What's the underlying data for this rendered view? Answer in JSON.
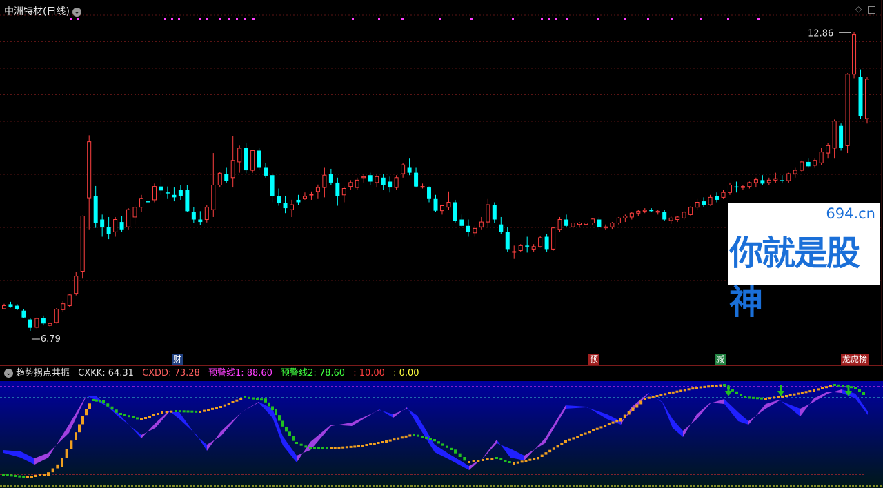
{
  "window": {
    "stock_title": "中洲特材(日线)"
  },
  "price_labels": {
    "high": "12.86",
    "low": "6.79"
  },
  "event_tags": [
    {
      "label": "财",
      "color": "#2060c0"
    },
    {
      "label": "预",
      "color": "#c83030"
    },
    {
      "label": "减",
      "color": "#20a040"
    },
    {
      "label": "龙虎榜",
      "color": "#c83030"
    }
  ],
  "logo": {
    "domain": "694.cn",
    "slogan": "你就是股神"
  },
  "indicator": {
    "name": "趋势拐点共振",
    "cxkk": "CXKK: 64.31",
    "cxdd": "CXDD: 73.28",
    "warn1": "预警线1: 88.60",
    "warn2": "预警线2: 78.60",
    "v10": ": 10.00",
    "v0": ": 0.00"
  },
  "colors": {
    "up": "#ff4040",
    "down": "#00ffff",
    "purple": "#a040e0",
    "blue": "#2020ff",
    "orange": "#f0a020",
    "green": "#20c020",
    "magenta": "#ff40ff"
  },
  "chart_data": {
    "type": "candlestick",
    "series": "daily OHLC (estimated)",
    "ylim": [
      6.3,
      13.2
    ],
    "candles": [
      [
        7.24,
        7.34,
        7.24,
        7.3
      ],
      [
        7.33,
        7.38,
        7.26,
        7.28
      ],
      [
        7.3,
        7.33,
        7.21,
        7.23
      ],
      [
        7.2,
        7.23,
        7.05,
        7.06
      ],
      [
        7.02,
        7.04,
        6.79,
        6.85
      ],
      [
        6.86,
        7.06,
        6.82,
        7.04
      ],
      [
        7.05,
        7.1,
        6.9,
        6.94
      ],
      [
        6.9,
        6.96,
        6.86,
        6.94
      ],
      [
        6.96,
        7.25,
        6.94,
        7.23
      ],
      [
        7.22,
        7.4,
        7.18,
        7.34
      ],
      [
        7.3,
        7.53,
        7.28,
        7.52
      ],
      [
        7.55,
        7.98,
        7.51,
        7.9
      ],
      [
        8.0,
        9.13,
        7.85,
        9.12
      ],
      [
        9.49,
        10.76,
        8.85,
        10.63
      ],
      [
        9.52,
        9.73,
        8.88,
        8.98
      ],
      [
        9.05,
        9.15,
        8.7,
        8.9
      ],
      [
        8.9,
        9.1,
        8.65,
        8.75
      ],
      [
        8.8,
        9.1,
        8.7,
        9.05
      ],
      [
        9.0,
        9.12,
        8.8,
        8.85
      ],
      [
        8.9,
        9.28,
        8.85,
        9.25
      ],
      [
        9.1,
        9.35,
        8.95,
        9.3
      ],
      [
        9.3,
        9.55,
        9.2,
        9.48
      ],
      [
        9.42,
        9.58,
        9.3,
        9.4
      ],
      [
        9.45,
        9.78,
        9.4,
        9.72
      ],
      [
        9.72,
        9.9,
        9.55,
        9.64
      ],
      [
        9.6,
        9.72,
        9.48,
        9.58
      ],
      [
        9.55,
        9.7,
        9.42,
        9.5
      ],
      [
        9.65,
        9.75,
        9.45,
        9.52
      ],
      [
        9.65,
        9.75,
        9.2,
        9.22
      ],
      [
        9.2,
        9.3,
        8.98,
        9.05
      ],
      [
        9.05,
        9.22,
        8.94,
        9.0
      ],
      [
        9.05,
        9.35,
        8.99,
        9.3
      ],
      [
        9.25,
        10.4,
        9.1,
        9.75
      ],
      [
        9.75,
        10.02,
        9.7,
        9.99
      ],
      [
        9.98,
        10.1,
        9.8,
        9.84
      ],
      [
        9.9,
        10.75,
        9.7,
        10.25
      ],
      [
        10.22,
        10.55,
        10.0,
        10.5
      ],
      [
        10.5,
        10.6,
        9.99,
        10.05
      ],
      [
        10.05,
        10.45,
        10.0,
        10.45
      ],
      [
        10.45,
        10.5,
        10.05,
        10.1
      ],
      [
        10.1,
        10.2,
        9.9,
        9.94
      ],
      [
        9.95,
        10.0,
        9.4,
        9.52
      ],
      [
        9.52,
        9.68,
        9.33,
        9.38
      ],
      [
        9.38,
        9.52,
        9.18,
        9.28
      ],
      [
        9.25,
        9.45,
        9.1,
        9.35
      ],
      [
        9.45,
        9.55,
        9.35,
        9.4
      ],
      [
        9.48,
        9.6,
        9.45,
        9.52
      ],
      [
        9.55,
        9.62,
        9.45,
        9.56
      ],
      [
        9.62,
        9.76,
        9.48,
        9.7
      ],
      [
        9.7,
        10.1,
        9.5,
        9.95
      ],
      [
        9.98,
        10.08,
        9.75,
        9.8
      ],
      [
        9.8,
        9.9,
        9.33,
        9.52
      ],
      [
        9.55,
        9.72,
        9.4,
        9.68
      ],
      [
        9.72,
        9.85,
        9.65,
        9.8
      ],
      [
        9.7,
        9.9,
        9.65,
        9.85
      ],
      [
        9.9,
        9.98,
        9.8,
        9.92
      ],
      [
        9.95,
        10.0,
        9.75,
        9.82
      ],
      [
        9.8,
        9.96,
        9.7,
        9.92
      ],
      [
        9.9,
        9.98,
        9.65,
        9.75
      ],
      [
        9.82,
        9.92,
        9.6,
        9.7
      ],
      [
        9.7,
        9.95,
        9.65,
        9.9
      ],
      [
        9.98,
        10.2,
        9.9,
        10.16
      ],
      [
        10.1,
        10.3,
        9.95,
        10.0
      ],
      [
        10.0,
        10.1,
        9.7,
        9.72
      ],
      [
        9.72,
        9.78,
        9.68,
        9.72
      ],
      [
        9.7,
        9.72,
        9.4,
        9.48
      ],
      [
        9.48,
        9.55,
        9.2,
        9.23
      ],
      [
        9.23,
        9.35,
        9.15,
        9.33
      ],
      [
        9.3,
        9.62,
        9.25,
        9.4
      ],
      [
        9.4,
        9.45,
        8.99,
        9.02
      ],
      [
        9.05,
        9.15,
        8.9,
        8.92
      ],
      [
        8.92,
        9.05,
        8.7,
        8.8
      ],
      [
        8.78,
        8.92,
        8.7,
        8.87
      ],
      [
        8.9,
        9.1,
        8.85,
        9.0
      ],
      [
        9.0,
        9.48,
        8.9,
        9.35
      ],
      [
        9.35,
        9.4,
        8.98,
        9.05
      ],
      [
        8.95,
        9.1,
        8.75,
        8.8
      ],
      [
        8.8,
        8.9,
        8.4,
        8.45
      ],
      [
        8.4,
        8.52,
        8.25,
        8.4
      ],
      [
        8.42,
        8.55,
        8.4,
        8.52
      ],
      [
        8.52,
        8.7,
        8.38,
        8.5
      ],
      [
        8.45,
        8.55,
        8.4,
        8.5
      ],
      [
        8.5,
        8.72,
        8.48,
        8.68
      ],
      [
        8.7,
        8.75,
        8.4,
        8.45
      ],
      [
        8.45,
        8.9,
        8.42,
        8.88
      ],
      [
        8.85,
        9.1,
        8.8,
        9.05
      ],
      [
        9.05,
        9.15,
        8.9,
        8.92
      ],
      [
        8.9,
        9.0,
        8.85,
        8.98
      ],
      [
        8.95,
        9.0,
        8.9,
        8.98
      ],
      [
        8.95,
        9.02,
        8.92,
        8.98
      ],
      [
        8.98,
        9.08,
        8.94,
        9.06
      ],
      [
        9.05,
        9.1,
        8.85,
        8.9
      ],
      [
        8.88,
        8.95,
        8.84,
        8.9
      ],
      [
        8.9,
        9.0,
        8.86,
        8.98
      ],
      [
        8.98,
        9.1,
        8.95,
        9.08
      ],
      [
        9.08,
        9.15,
        9.0,
        9.12
      ],
      [
        9.1,
        9.2,
        9.05,
        9.18
      ],
      [
        9.18,
        9.25,
        9.12,
        9.22
      ],
      [
        9.22,
        9.28,
        9.18,
        9.24
      ],
      [
        9.24,
        9.28,
        9.2,
        9.22
      ],
      [
        9.2,
        9.24,
        9.15,
        9.22
      ],
      [
        9.2,
        9.25,
        9.02,
        9.05
      ],
      [
        9.03,
        9.12,
        8.96,
        9.08
      ],
      [
        9.05,
        9.12,
        9.0,
        9.1
      ],
      [
        9.08,
        9.22,
        9.05,
        9.2
      ],
      [
        9.15,
        9.32,
        9.12,
        9.3
      ],
      [
        9.3,
        9.48,
        9.25,
        9.4
      ],
      [
        9.42,
        9.5,
        9.3,
        9.35
      ],
      [
        9.35,
        9.55,
        9.33,
        9.5
      ],
      [
        9.52,
        9.6,
        9.4,
        9.45
      ],
      [
        9.5,
        9.65,
        9.48,
        9.6
      ],
      [
        9.6,
        9.8,
        9.55,
        9.75
      ],
      [
        9.72,
        9.82,
        9.6,
        9.7
      ],
      [
        9.7,
        9.75,
        9.65,
        9.72
      ],
      [
        9.72,
        9.82,
        9.68,
        9.8
      ],
      [
        9.8,
        9.9,
        9.7,
        9.86
      ],
      [
        9.85,
        9.95,
        9.75,
        9.78
      ],
      [
        9.8,
        9.9,
        9.75,
        9.85
      ],
      [
        9.85,
        10.0,
        9.8,
        9.88
      ],
      [
        9.85,
        9.95,
        9.8,
        9.84
      ],
      [
        9.84,
        10.0,
        9.8,
        9.98
      ],
      [
        9.98,
        10.1,
        9.9,
        10.05
      ],
      [
        10.05,
        10.25,
        10.02,
        10.22
      ],
      [
        10.22,
        10.3,
        10.1,
        10.13
      ],
      [
        10.15,
        10.3,
        10.1,
        10.25
      ],
      [
        10.2,
        10.5,
        10.15,
        10.42
      ],
      [
        10.4,
        10.6,
        10.3,
        10.55
      ],
      [
        10.5,
        11.08,
        10.3,
        11.05
      ],
      [
        10.95,
        11.0,
        10.45,
        10.5
      ],
      [
        10.55,
        12.02,
        10.4,
        12.0
      ],
      [
        12.0,
        12.86,
        11.92,
        12.8
      ],
      [
        11.95,
        12.1,
        11.1,
        11.15
      ],
      [
        11.1,
        11.95,
        11.0,
        11.9
      ]
    ]
  }
}
